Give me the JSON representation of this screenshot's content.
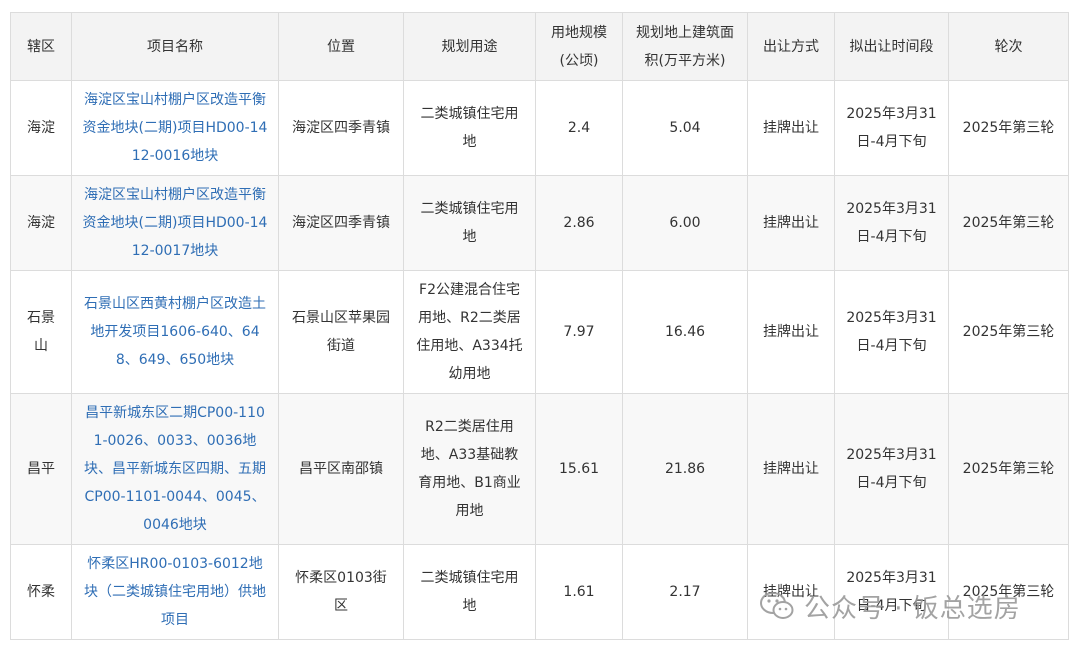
{
  "table": {
    "headers": [
      "辖区",
      "项目名称",
      "位置",
      "规划用途",
      "用地规模(公顷)",
      "规划地上建筑面积(万平方米)",
      "出让方式",
      "拟出让时间段",
      "轮次"
    ],
    "rows": [
      [
        "海淀",
        "海淀区宝山村棚户区改造平衡资金地块(二期)项目HD00-1412-0016地块",
        "海淀区四季青镇",
        "二类城镇住宅用地",
        "2.4",
        "5.04",
        "挂牌出让",
        "2025年3月31日-4月下旬",
        "2025年第三轮"
      ],
      [
        "海淀",
        "海淀区宝山村棚户区改造平衡资金地块(二期)项目HD00-1412-0017地块",
        "海淀区四季青镇",
        "二类城镇住宅用地",
        "2.86",
        "6.00",
        "挂牌出让",
        "2025年3月31日-4月下旬",
        "2025年第三轮"
      ],
      [
        "石景山",
        "石景山区西黄村棚户区改造土地开发项目1606-640、648、649、650地块",
        "石景山区苹果园街道",
        "F2公建混合住宅用地、R2二类居住用地、A334托幼用地",
        "7.97",
        "16.46",
        "挂牌出让",
        "2025年3月31日-4月下旬",
        "2025年第三轮"
      ],
      [
        "昌平",
        "昌平新城东区二期CP00-1101-0026、0033、0036地块、昌平新城东区四期、五期CP00-1101-0044、0045、0046地块",
        "昌平区南邵镇",
        "R2二类居住用地、A33基础教育用地、B1商业用地",
        "15.61",
        "21.86",
        "挂牌出让",
        "2025年3月31日-4月下旬",
        "2025年第三轮"
      ],
      [
        "怀柔",
        "怀柔区HR00-0103-6012地块（二类城镇住宅用地）供地项目",
        "怀柔区0103街区",
        "二类城镇住宅用地",
        "1.61",
        "2.17",
        "挂牌出让",
        "2025年3月31日-4月下旬",
        "2025年第三轮"
      ]
    ]
  },
  "watermark": {
    "text": "公众号 · 饭总选房",
    "icon": "wechat-icon"
  },
  "colors": {
    "link": "#2f6eb5",
    "header_bg": "#f3f3f3",
    "border": "#dcdcdc",
    "text": "#333333",
    "watermark": "#9a9a9a"
  }
}
